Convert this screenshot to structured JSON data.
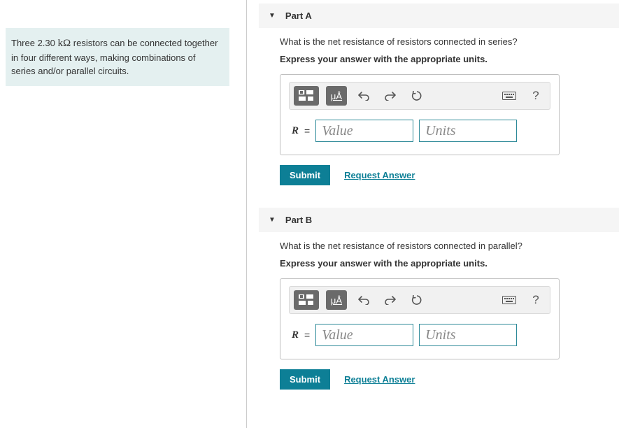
{
  "problem": {
    "text_pre": "Three 2.30 ",
    "unit": "kΩ",
    "text_post": " resistors can be connected together in four different ways, making combinations of series and/or parallel circuits."
  },
  "parts": [
    {
      "header": "Part A",
      "question": "What is the net resistance of resistors connected in series?",
      "instruction": "Express your answer with the appropriate units.",
      "var": "R",
      "value_placeholder": "Value",
      "units_placeholder": "Units",
      "submit": "Submit",
      "request": "Request Answer"
    },
    {
      "header": "Part B",
      "question": "What is the net resistance of resistors connected in parallel?",
      "instruction": "Express your answer with the appropriate units.",
      "var": "R",
      "value_placeholder": "Value",
      "units_placeholder": "Units",
      "submit": "Submit",
      "request": "Request Answer"
    }
  ],
  "toolbar": {
    "mu_a": "μÅ",
    "help": "?"
  }
}
